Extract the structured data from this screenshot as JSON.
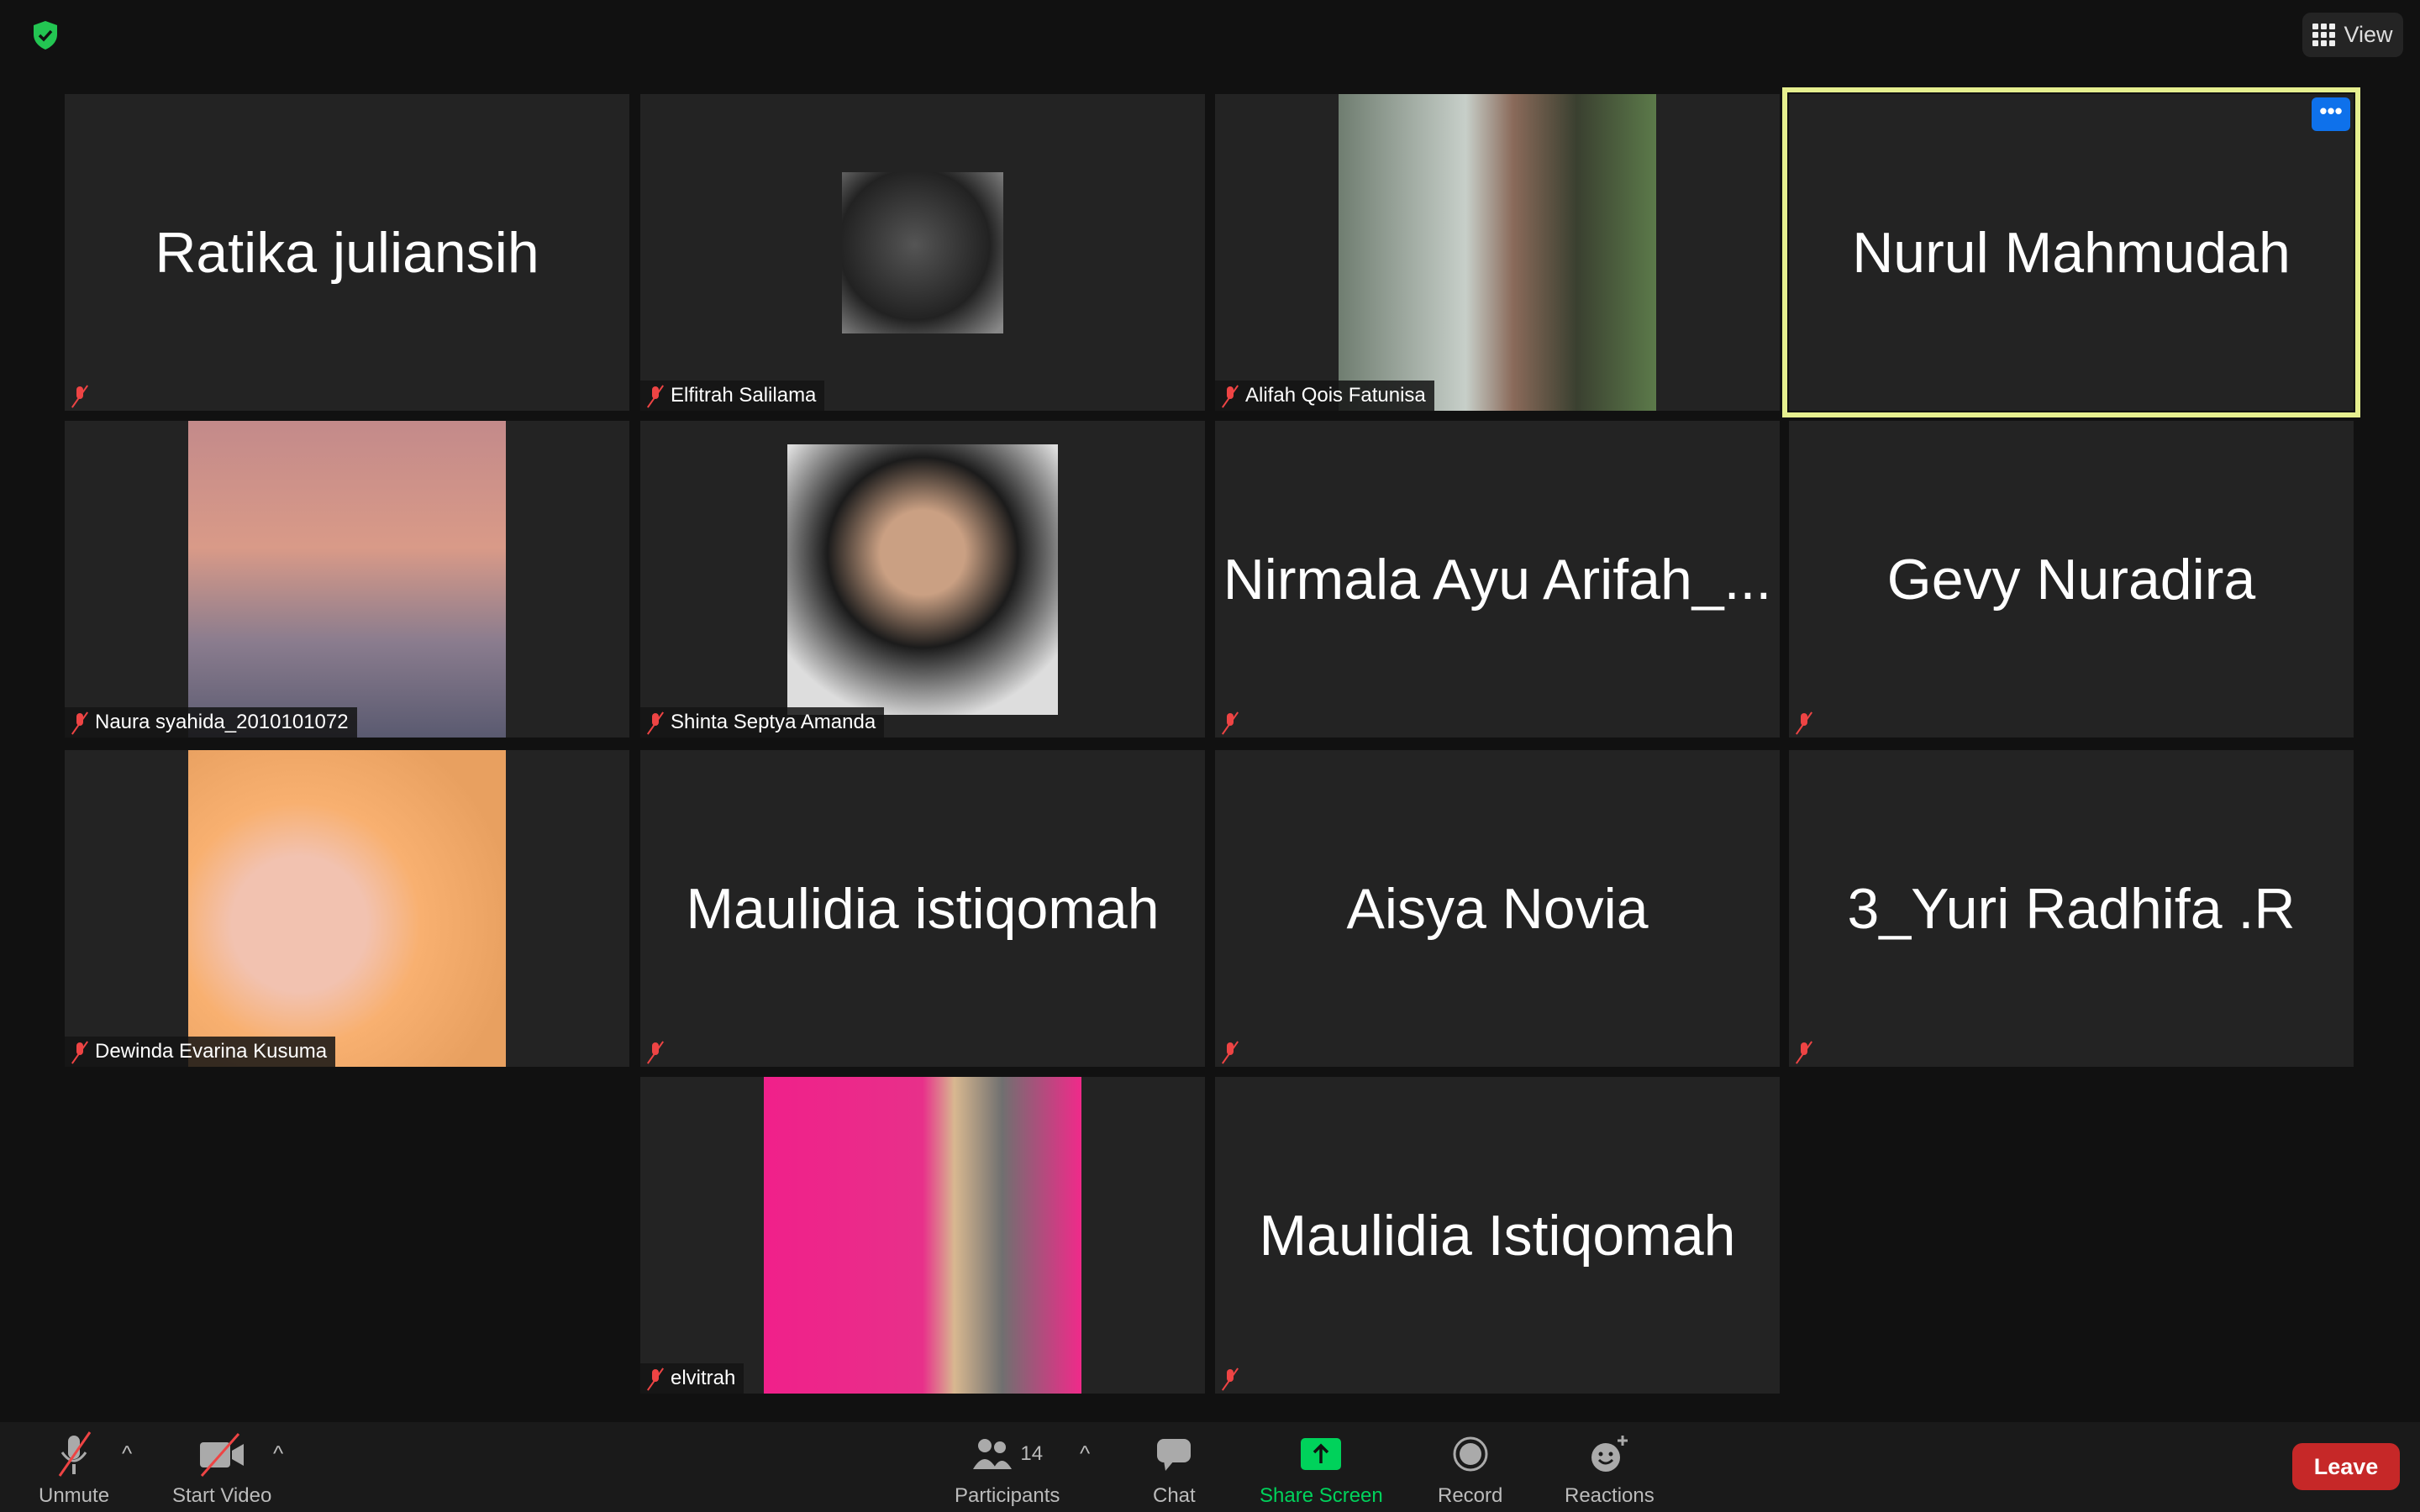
{
  "header": {
    "view_label": "View",
    "security_icon": "shield-check-icon"
  },
  "tiles": [
    {
      "name": "Ratika juliansih",
      "show_name": true,
      "video": false
    },
    {
      "name": "Elfitrah Salilama",
      "video": true
    },
    {
      "name": "Alifah Qois Fatunisa",
      "video": true
    },
    {
      "name": "Nurul Mahmudah",
      "show_name": true,
      "active": true,
      "more": "•••"
    },
    {
      "name": "Naura syahida_2010101072",
      "video": true
    },
    {
      "name": "Shinta Septya Amanda",
      "video": true
    },
    {
      "name": "Nirmala Ayu Arifah_...",
      "show_name": true
    },
    {
      "name": "Gevy Nuradira",
      "show_name": true
    },
    {
      "name": "Dewinda Evarina Kusuma",
      "video": true
    },
    {
      "name": "Maulidia istiqomah",
      "show_name": true
    },
    {
      "name": "Aisya Novia",
      "show_name": true
    },
    {
      "name": "3_Yuri Radhifa .R",
      "show_name": true
    },
    {
      "name": "elvitrah",
      "video": true
    },
    {
      "name": "Maulidia Istiqomah",
      "show_name": true
    }
  ],
  "toolbar": {
    "unmute": "Unmute",
    "start_video": "Start Video",
    "participants": "Participants",
    "participant_count": "14",
    "chat": "Chat",
    "share_screen": "Share Screen",
    "record": "Record",
    "reactions": "Reactions",
    "leave": "Leave"
  },
  "colors": {
    "accent_green": "#00d25b",
    "leave_red": "#c62828",
    "active_speaker": "#e6ef8f",
    "more_blue": "#0e71eb"
  }
}
